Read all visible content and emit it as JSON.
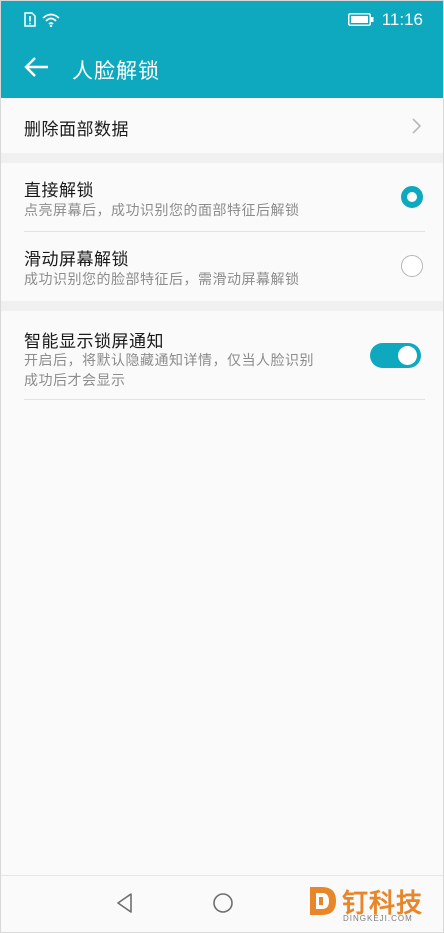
{
  "status_bar": {
    "time": "11:16",
    "icons": [
      "sim-alert-icon",
      "wifi-icon",
      "battery-icon"
    ]
  },
  "header": {
    "title": "人脸解锁",
    "back_icon": "arrow-left-icon"
  },
  "colors": {
    "accent": "#0fa9bf",
    "background": "#fafafa",
    "section_gap": "#f0f0f0",
    "watermark_orange": "#e8862a"
  },
  "settings": {
    "delete_face_data": {
      "label": "删除面部数据",
      "icon": "chevron-right-icon"
    },
    "unlock_options": [
      {
        "title": "直接解锁",
        "subtitle": "点亮屏幕后，成功识别您的面部特征后解锁",
        "selected": true
      },
      {
        "title": "滑动屏幕解锁",
        "subtitle": "成功识别您的脸部特征后，需滑动屏幕解锁",
        "selected": false
      }
    ],
    "smart_notification": {
      "title": "智能显示锁屏通知",
      "subtitle_line1": "开启后，将默认隐藏通知详情，仅当人脸识别",
      "subtitle_line2": "成功后才会显示",
      "enabled": true
    }
  },
  "nav_bar": {
    "buttons": [
      "back-triangle-icon",
      "home-circle-icon",
      "recents-square-icon"
    ]
  },
  "watermark": {
    "text": "钉科技",
    "sub": "DINGKEJI.COM"
  }
}
